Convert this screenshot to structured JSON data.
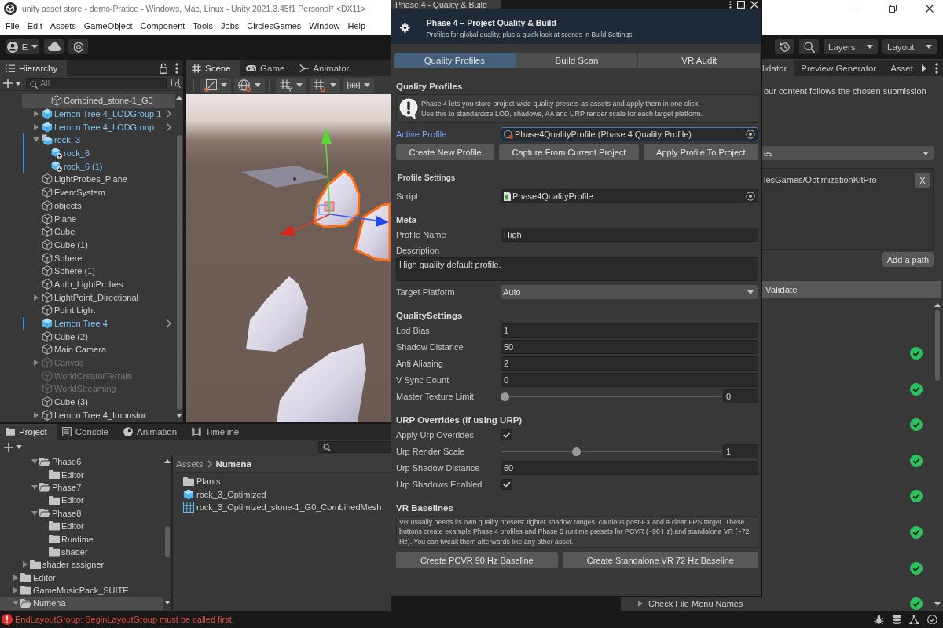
{
  "titlebar": {
    "title": "unity asset store - demo-Pratice - Windows, Mac, Linux - Unity 2021.3.45f1 Personal* <DX11>"
  },
  "menu": [
    "File",
    "Edit",
    "Assets",
    "GameObject",
    "Component",
    "Tools",
    "Jobs",
    "CirclesGames",
    "Window",
    "Help"
  ],
  "toolbar": {
    "account": "E",
    "dropdowns": [
      "Layers",
      "Layout"
    ]
  },
  "hierarchy": {
    "tabs": [
      {
        "label": "Hierarchy",
        "kind": "hierarchy",
        "selected": true
      }
    ],
    "search": {
      "placeholder": "All"
    },
    "items": [
      {
        "children": [
          {
            "label": "Combined_stone-1_G0",
            "kind": "object",
            "selected": true,
            "disabled": false,
            "overridden": false
          }
        ]
      },
      {
        "label": "Lemon Tree 4_LODGroup 1",
        "kind": "prefab",
        "selected": false,
        "disabled": false,
        "overridden": false,
        "expanded": false
      },
      {
        "label": "Lemon Tree 4_LODGroup",
        "kind": "prefab",
        "selected": false,
        "disabled": false,
        "overridden": false,
        "expanded": false
      },
      {
        "label": "rock_3",
        "kind": "model_prefab",
        "selected": false,
        "disabled": false,
        "overridden": true,
        "expanded": true,
        "children": [
          {
            "label": "rock_6",
            "kind": "added_prefab",
            "selected": false,
            "disabled": false,
            "overridden": true
          },
          {
            "label": "rock_6 (1)",
            "kind": "added_prefab",
            "selected": false,
            "disabled": false,
            "overridden": true
          }
        ]
      },
      {
        "label": "LightProbes_Plane",
        "kind": "object",
        "selected": false,
        "disabled": false,
        "overridden": false
      },
      {
        "label": "EventSystem",
        "kind": "object",
        "selected": false,
        "disabled": false,
        "overridden": false
      },
      {
        "label": "objects",
        "kind": "object",
        "selected": false,
        "disabled": false,
        "overridden": false
      },
      {
        "label": "Plane",
        "kind": "object",
        "selected": false,
        "disabled": false,
        "overridden": false
      },
      {
        "label": "Cube",
        "kind": "object",
        "selected": false,
        "disabled": false,
        "overridden": false
      },
      {
        "label": "Cube (1)",
        "kind": "object",
        "selected": false,
        "disabled": false,
        "overridden": false
      },
      {
        "label": "Sphere",
        "kind": "object",
        "selected": false,
        "disabled": false,
        "overridden": false
      },
      {
        "label": "Sphere (1)",
        "kind": "object",
        "selected": false,
        "disabled": false,
        "overridden": false
      },
      {
        "label": "Auto_LightProbes",
        "kind": "object",
        "selected": false,
        "disabled": false,
        "overridden": false
      },
      {
        "label": "LightPoint_Directional",
        "kind": "object",
        "selected": false,
        "disabled": false,
        "overridden": false,
        "expanded": false
      },
      {
        "label": "Point Light",
        "kind": "object",
        "selected": false,
        "disabled": false,
        "overridden": false
      },
      {
        "label": "Lemon Tree 4",
        "kind": "prefab",
        "selected": false,
        "disabled": false,
        "overridden": true
      },
      {
        "label": "Cube (2)",
        "kind": "object",
        "selected": false,
        "disabled": false,
        "overridden": false
      },
      {
        "label": "Main Camera",
        "kind": "object",
        "selected": false,
        "disabled": false,
        "overridden": false
      },
      {
        "label": "Canvas",
        "kind": "object",
        "selected": false,
        "disabled": true,
        "overridden": false,
        "expanded": false
      },
      {
        "label": "WorldCreatorTerrain",
        "kind": "object",
        "selected": false,
        "disabled": true,
        "overridden": false
      },
      {
        "label": "WorldStreaming",
        "kind": "object",
        "selected": false,
        "disabled": true,
        "overridden": false
      },
      {
        "label": "Cube (3)",
        "kind": "object",
        "selected": false,
        "disabled": false,
        "overridden": false
      },
      {
        "label": "Lemon Tree 4_Impostor",
        "kind": "object",
        "selected": false,
        "disabled": false,
        "overridden": false,
        "expanded": false
      }
    ]
  },
  "scene": {
    "tabs": [
      {
        "label": "Scene",
        "kind": "scene",
        "selected": true
      },
      {
        "label": "Game",
        "kind": "game",
        "selected": false
      },
      {
        "label": "Animator",
        "kind": "animator",
        "selected": false
      }
    ]
  },
  "project": {
    "tabs": [
      {
        "label": "Project",
        "kind": "project",
        "selected": true
      },
      {
        "label": "Console",
        "kind": "console",
        "selected": false
      },
      {
        "label": "Animation",
        "kind": "animation",
        "selected": false
      },
      {
        "label": "Timeline",
        "kind": "timeline",
        "selected": false
      }
    ],
    "folders": [
      {
        "children": [
          {
            "children": [
              {
                "label": "Phase6",
                "selected": false,
                "expanded": true,
                "children": [
                  {
                    "label": "Editor",
                    "selected": false
                  }
                ]
              },
              {
                "label": "Phase7",
                "selected": false,
                "expanded": true,
                "children": [
                  {
                    "label": "Editor",
                    "selected": false
                  }
                ]
              },
              {
                "label": "Phase8",
                "selected": false,
                "expanded": true,
                "children": [
                  {
                    "label": "Editor",
                    "selected": false
                  },
                  {
                    "label": "Runtime",
                    "selected": false
                  },
                  {
                    "label": "shader",
                    "selected": false
                  }
                ]
              }
            ]
          },
          {
            "label": "shader assigner",
            "selected": false,
            "expanded": false
          }
        ]
      },
      {
        "label": "Editor",
        "selected": false,
        "expanded": false
      },
      {
        "label": "GameMusicPack_SUITE",
        "selected": false,
        "expanded": false
      },
      {
        "label": "Numena",
        "selected": true,
        "expanded": true
      }
    ],
    "breadcrumb": [
      "Assets",
      "Numena"
    ],
    "assets": [
      {
        "label": "Plants",
        "kind": "folder"
      },
      {
        "label": "rock_3_Optimized",
        "kind": "prefab"
      },
      {
        "label": "rock_3_Optimized_stone-1_G0_CombinedMesh",
        "kind": "mesh"
      }
    ]
  },
  "floating_window": {
    "tab_title": "Phase 4 - Quality & Build",
    "header": {
      "title": "Phase 4 – Project Quality & Build",
      "subtitle": "Profiles for global quality, plus a quick look at scenes in Build Settings."
    },
    "tabs": [
      {
        "label": "Quality Profiles",
        "selected": true
      },
      {
        "label": "Build Scan",
        "selected": false
      },
      {
        "label": "VR Audit",
        "selected": false
      }
    ],
    "rows": [
      {
        "kind": "heading",
        "text": "Quality Profiles"
      },
      {
        "kind": "notice",
        "text": "Phase 4 lets you store project-wide quality presets as assets and apply them in one click.\nUse this to standardize LOD, shadows, AA and URP render scale for each target platform."
      },
      {
        "kind": "asset_field",
        "label": "Active Profile",
        "value": "Phase4QualityProfile (Phase 4 Quality Profile)",
        "focused": true
      },
      {
        "kind": "buttons",
        "buttons": [
          "Create New Profile",
          "Capture From Current Project",
          "Apply Profile To Project"
        ]
      },
      {
        "kind": "subheading",
        "text": "Profile Settings"
      },
      {
        "kind": "script_field",
        "label": "Script",
        "value": "Phase4QualityProfile",
        "focused": false
      },
      {
        "kind": "heading",
        "text": "Meta"
      },
      {
        "kind": "text_field",
        "label": "Profile Name",
        "value": "High"
      },
      {
        "kind": "label",
        "text": "Description"
      },
      {
        "kind": "textarea",
        "value": "High quality default profile."
      },
      {
        "kind": "dropdown",
        "label": "Target Platform",
        "value": "Auto"
      },
      {
        "kind": "heading",
        "text": "QualitySettings"
      },
      {
        "kind": "text_field",
        "label": "Lod Bias",
        "value": "1"
      },
      {
        "kind": "text_field",
        "label": "Shadow Distance",
        "value": "50"
      },
      {
        "kind": "text_field",
        "label": "Anti Aliasing",
        "value": "2"
      },
      {
        "kind": "text_field",
        "label": "V Sync Count",
        "value": "0"
      },
      {
        "kind": "slider",
        "label": "Master Texture Limit",
        "level": 0,
        "value": "0"
      },
      {
        "kind": "heading",
        "text": "URP Overrides (if using URP)"
      },
      {
        "kind": "checkbox",
        "label": "Apply Urp Overrides",
        "checked": true
      },
      {
        "kind": "slider",
        "label": "Urp Render Scale",
        "level": 0.34,
        "value": "1"
      },
      {
        "kind": "text_field",
        "label": "Urp Shadow Distance",
        "value": "50"
      },
      {
        "kind": "checkbox",
        "label": "Urp Shadows Enabled",
        "checked": true
      },
      {
        "kind": "heading",
        "text": "VR Baselines"
      },
      {
        "kind": "help",
        "text": "VR usually needs its own quality presets: tighter shadow ranges, cautious post-FX and a clear FPS target. These buttons create example Phase 4 profiles and Phase 5 runtime presets for PCVR (~90 Hz) and standalone VR (~72 Hz). You can tweak them afterwards like any other asset."
      },
      {
        "kind": "buttons",
        "buttons": [
          "Create PCVR 90 Hz Baseline",
          "Create Standalone VR 72 Hz Baseline"
        ]
      }
    ]
  },
  "inspector": {
    "tabs": [
      {
        "label": "lidator",
        "selected": true
      },
      {
        "label": "Preview Generator",
        "selected": false
      },
      {
        "label": "Asset",
        "selected": false
      }
    ],
    "text": "our content follows the chosen submission",
    "dropdown": "es",
    "paths": [
      {
        "path": "lesGames/OptimizationKitPro",
        "button": "X"
      }
    ],
    "add_button": "Add a path",
    "validate_button": "Validate",
    "checks": [
      {
        "passed": true
      },
      {
        "passed": true
      },
      {
        "passed": true
      },
      {
        "passed": true
      },
      {
        "passed": true
      },
      {
        "passed": true
      },
      {
        "passed": true
      },
      {
        "name": "Check File Menu Names",
        "passed": true
      }
    ]
  },
  "status_bar": {
    "message": "EndLayoutGroup: BeginLayoutGroup must be called first."
  }
}
